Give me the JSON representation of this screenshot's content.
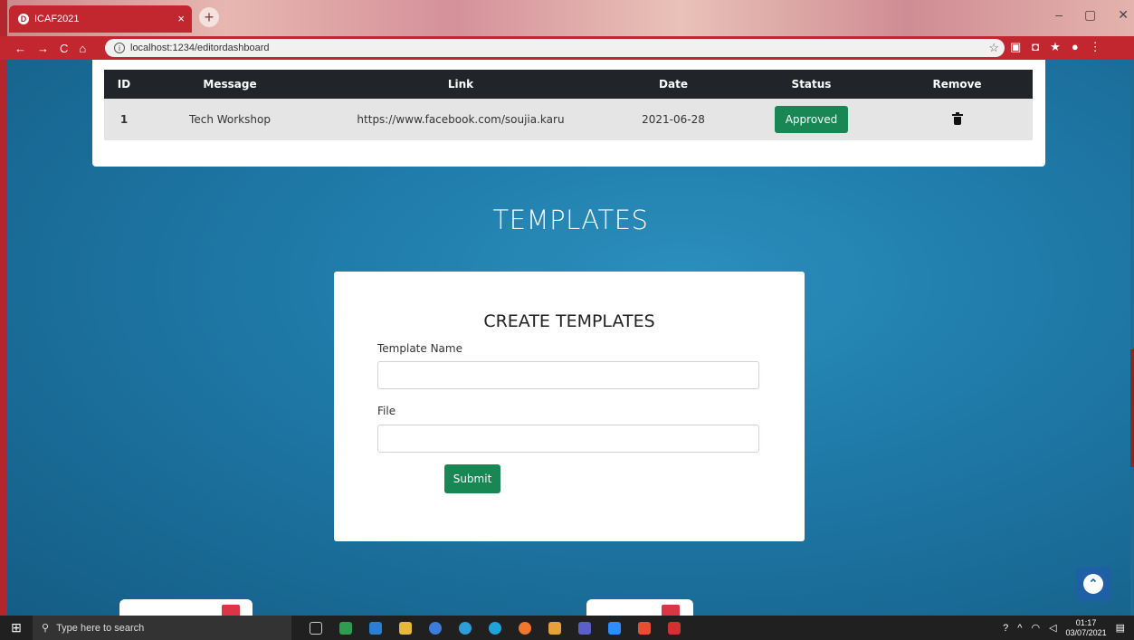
{
  "browser": {
    "tab_title": "ICAF2021",
    "tab_close": "×",
    "new_tab": "+",
    "url": "localhost:1234/editordashboard",
    "window_buttons": [
      "–",
      "▢",
      "✕"
    ]
  },
  "messages_table": {
    "columns": [
      "ID",
      "Message",
      "Link",
      "Date",
      "Status",
      "Remove"
    ],
    "rows": [
      {
        "id": "1",
        "message": "Tech Workshop",
        "link": "https://www.facebook.com/soujia.karu",
        "date": "2021-06-28",
        "status": "Approved"
      }
    ]
  },
  "templates": {
    "section_title": "TEMPLATES",
    "form_title": "CREATE TEMPLATES",
    "name_label": "Template Name",
    "file_label": "File",
    "submit_label": "Submit"
  },
  "taskbar": {
    "search_placeholder": "Type here to search",
    "time": "01:17",
    "date": "03/07/2021"
  },
  "colors": {
    "accent_green": "#198754",
    "header_dark": "#212529",
    "browser_red": "#c2262f"
  }
}
